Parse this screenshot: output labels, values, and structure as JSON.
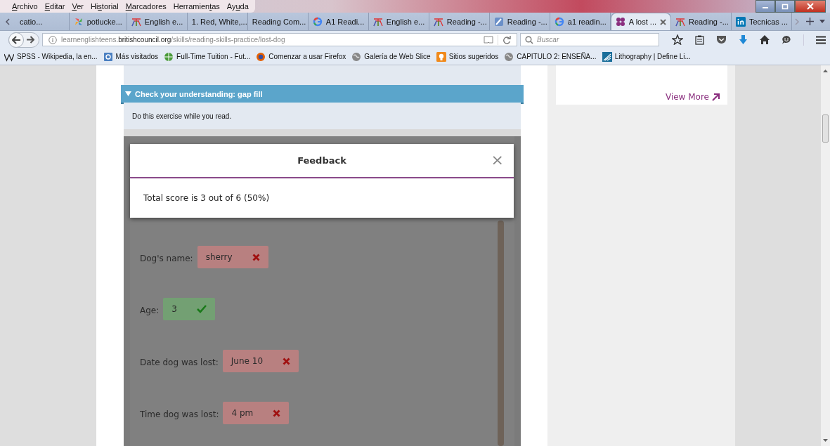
{
  "menu_bar": {
    "items": [
      {
        "access_key": "A",
        "rest": "rchivo"
      },
      {
        "access_key": "E",
        "rest": "ditar"
      },
      {
        "access_key": "V",
        "rest": "er"
      },
      {
        "lead": "Hi",
        "access_key": "s",
        "rest": "torial"
      },
      {
        "access_key": "M",
        "rest": "arcadores"
      },
      {
        "lead": "Herramien",
        "access_key": "t",
        "rest": "as"
      },
      {
        "lead": "Ay",
        "access_key": "u",
        "rest": "da"
      }
    ]
  },
  "tabs": [
    {
      "label": "catio...",
      "kind": "none",
      "selected": false
    },
    {
      "label": "potlucke...",
      "kind": "pinwheel",
      "selected": false
    },
    {
      "label": "English e...",
      "kind": "ef",
      "selected": false
    },
    {
      "label": "1. Red, White,...",
      "kind": "none",
      "selected": false
    },
    {
      "label": "Reading Com...",
      "kind": "none",
      "selected": false
    },
    {
      "label": "A1 Readi...",
      "kind": "google",
      "selected": false
    },
    {
      "label": "English e...",
      "kind": "ef",
      "selected": false
    },
    {
      "label": "Reading -...",
      "kind": "ef",
      "selected": false
    },
    {
      "label": "Reading -...",
      "kind": "pen",
      "selected": false
    },
    {
      "label": "a1 readin...",
      "kind": "google",
      "selected": false
    },
    {
      "label": "A lost ...",
      "kind": "dots",
      "selected": true
    },
    {
      "label": "Reading -...",
      "kind": "ef",
      "selected": false
    },
    {
      "label": "Tecnicas ...",
      "kind": "linkedin",
      "selected": false
    }
  ],
  "address_bar": {
    "url_parts": [
      {
        "text": "learnenglishteens.",
        "emphasis": false
      },
      {
        "text": "britishcouncil.org",
        "emphasis": true
      },
      {
        "text": "/skills/reading-skills-practice/lost-dog",
        "emphasis": false
      }
    ]
  },
  "search": {
    "placeholder": "Buscar"
  },
  "bookmarks": [
    {
      "label": "SPSS - Wikipedia, la en...",
      "kind": "wiki"
    },
    {
      "label": "Más visitados",
      "kind": "folder"
    },
    {
      "label": "Full-Time Tuition - Fut...",
      "kind": "green-globe"
    },
    {
      "label": "Comenzar a usar Firefox",
      "kind": "firefox"
    },
    {
      "label": "Galería de Web Slice",
      "kind": "globe"
    },
    {
      "label": "Sitios sugeridos",
      "kind": "bulb"
    },
    {
      "label": "CAPITULO 2: ENSEÑA...",
      "kind": "globe"
    },
    {
      "label": "Lithography | Define Li...",
      "kind": "litho"
    }
  ],
  "section": {
    "title": "Check your understanding: gap fill",
    "instruction": "Do this exercise while you read."
  },
  "feedback": {
    "title": "Feedback",
    "close": "×",
    "message": "Total score is 3 out of 6 (50%)"
  },
  "answers": [
    {
      "label": "Dog's name:",
      "value": "sherry",
      "correct": false
    },
    {
      "label": "Age:",
      "value": "3",
      "correct": true
    },
    {
      "label": "Date dog was lost:",
      "value": "June 10",
      "correct": false
    },
    {
      "label": "Time dog was lost:",
      "value": "4 pm",
      "correct": false
    }
  ],
  "sidebar": {
    "link": "View More"
  }
}
